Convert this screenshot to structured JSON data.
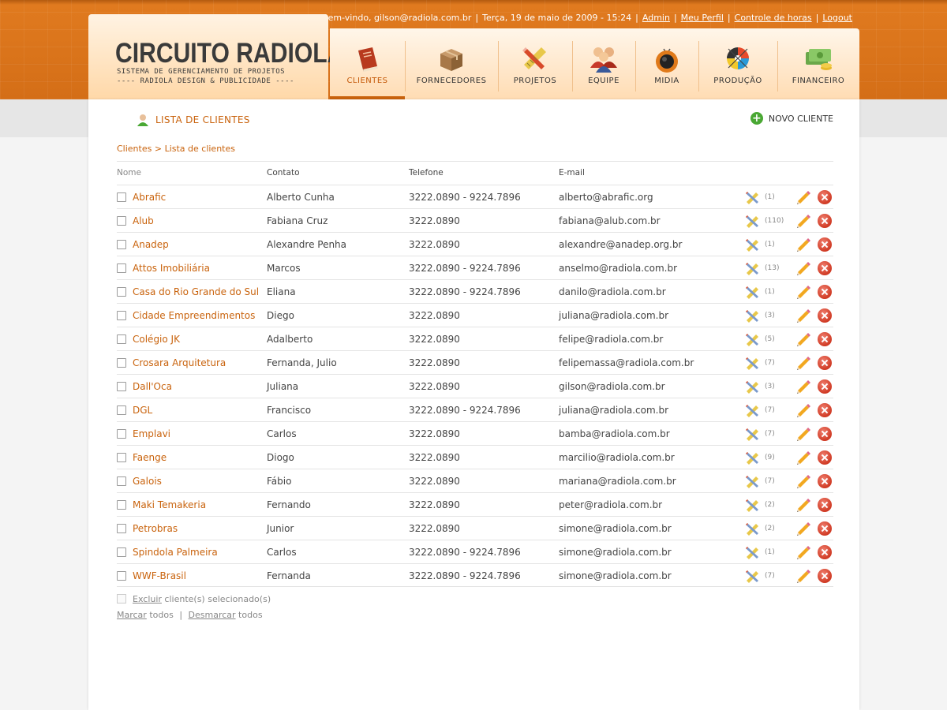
{
  "header": {
    "greeting": "Bem-vindo, gilson@radiola.com.br",
    "date": "Terça, 19 de maio de 2009 - 15:24",
    "links": [
      "Admin",
      "Meu Perfil",
      "Controle de horas",
      "Logout"
    ]
  },
  "logo": {
    "title": "CIRCUITO RADIOLA",
    "line1": "SISTEMA DE GERENCIAMENTO DE PROJETOS",
    "line2": "---- RADIOLA DESIGN & PUBLICIDADE ----"
  },
  "nav": [
    {
      "label": "CLIENTES",
      "icon": "book-icon",
      "active": true
    },
    {
      "label": "FORNECEDORES",
      "icon": "box-icon"
    },
    {
      "label": "PROJETOS",
      "icon": "pencil-ruler-icon"
    },
    {
      "label": "EQUIPE",
      "icon": "team-icon"
    },
    {
      "label": "MIDIA",
      "icon": "tv-icon"
    },
    {
      "label": "PRODUÇÃO",
      "icon": "color-wheel-icon"
    },
    {
      "label": "FINANCEIRO",
      "icon": "money-icon"
    }
  ],
  "page": {
    "title": "LISTA DE CLIENTES",
    "new_button": "NOVO CLIENTE",
    "breadcrumb": {
      "root": "Clientes",
      "sep": ">",
      "current": "Lista de clientes"
    }
  },
  "table": {
    "headers": {
      "name": "Nome",
      "contact": "Contato",
      "phone": "Telefone",
      "email": "E-mail"
    },
    "rows": [
      {
        "name": "Abrafic",
        "contact": "Alberto Cunha",
        "phone": "3222.0890 - 9224.7896",
        "email": "alberto@abrafic.org",
        "count": "(1)"
      },
      {
        "name": "Alub",
        "contact": "Fabiana Cruz",
        "phone": "3222.0890",
        "email": "fabiana@alub.com.br",
        "count": "(110)"
      },
      {
        "name": "Anadep",
        "contact": "Alexandre Penha",
        "phone": "3222.0890",
        "email": "alexandre@anadep.org.br",
        "count": "(1)"
      },
      {
        "name": "Attos Imobiliária",
        "contact": "Marcos",
        "phone": "3222.0890 - 9224.7896",
        "email": "anselmo@radiola.com.br",
        "count": "(13)"
      },
      {
        "name": "Casa do Rio Grande do Sul",
        "contact": "Eliana",
        "phone": "3222.0890 - 9224.7896",
        "email": "danilo@radiola.com.br",
        "count": "(1)"
      },
      {
        "name": "Cidade Empreendimentos",
        "contact": "Diego",
        "phone": "3222.0890",
        "email": "juliana@radiola.com.br",
        "count": "(3)"
      },
      {
        "name": "Colégio JK",
        "contact": "Adalberto",
        "phone": "3222.0890",
        "email": "felipe@radiola.com.br",
        "count": "(5)"
      },
      {
        "name": "Crosara Arquitetura",
        "contact": "Fernanda, Julio",
        "phone": "3222.0890",
        "email": "felipemassa@radiola.com.br",
        "count": "(7)"
      },
      {
        "name": "Dall'Oca",
        "contact": "Juliana",
        "phone": "3222.0890",
        "email": "gilson@radiola.com.br",
        "count": "(3)"
      },
      {
        "name": "DGL",
        "contact": "Francisco",
        "phone": "3222.0890 - 9224.7896",
        "email": "juliana@radiola.com.br",
        "count": "(7)"
      },
      {
        "name": "Emplavi",
        "contact": "Carlos",
        "phone": "3222.0890",
        "email": "bamba@radiola.com.br",
        "count": "(7)"
      },
      {
        "name": "Faenge",
        "contact": "Diogo",
        "phone": "3222.0890",
        "email": "marcilio@radiola.com.br",
        "count": "(9)"
      },
      {
        "name": "Galois",
        "contact": "Fábio",
        "phone": "3222.0890",
        "email": "mariana@radiola.com.br",
        "count": "(7)"
      },
      {
        "name": "Maki Temakeria",
        "contact": "Fernando",
        "phone": "3222.0890",
        "email": "peter@radiola.com.br",
        "count": "(2)"
      },
      {
        "name": "Petrobras",
        "contact": "Junior",
        "phone": "3222.0890",
        "email": "simone@radiola.com.br",
        "count": "(2)"
      },
      {
        "name": "Spindola Palmeira",
        "contact": "Carlos",
        "phone": "3222.0890 - 9224.7896",
        "email": "simone@radiola.com.br",
        "count": "(1)"
      },
      {
        "name": "WWF-Brasil",
        "contact": "Fernanda",
        "phone": "3222.0890 - 9224.7896",
        "email": "simone@radiola.com.br",
        "count": "(7)"
      }
    ]
  },
  "bulk": {
    "delete_link": "Excluir",
    "delete_rest": " cliente(s) selecionado(s)",
    "select_all": "Marcar",
    "select_all_rest": " todos",
    "unselect_all": "Desmarcar",
    "unselect_all_rest": " todos"
  },
  "colors": {
    "accent": "#c9630d",
    "header": "#d9731a",
    "add": "#4aa834",
    "delete": "#d03a24"
  }
}
